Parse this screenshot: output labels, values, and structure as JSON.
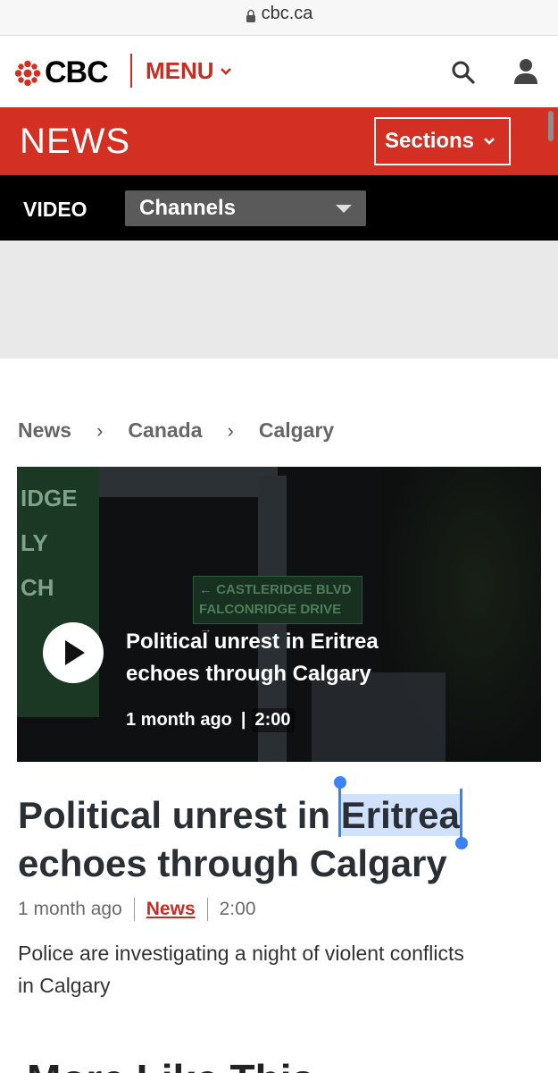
{
  "browser": {
    "url": "cbc.ca",
    "lock_icon": "lock-icon"
  },
  "header": {
    "logo_text": "CBC",
    "menu_label": "MENU",
    "icons": [
      "cbc-gem-icon",
      "chevron-down-icon",
      "search-icon",
      "user-icon"
    ],
    "brand_color": "#d32f23"
  },
  "news_bar": {
    "title": "NEWS",
    "sections_label": "Sections"
  },
  "video_bar": {
    "label": "VIDEO",
    "channels_selected": "Channels"
  },
  "breadcrumb": [
    {
      "label": "News"
    },
    {
      "label": "Canada"
    },
    {
      "label": "Calgary"
    }
  ],
  "player": {
    "title": "Political unrest in Eritrea echoes through Calgary",
    "age": "1 month ago",
    "duration": "2:00",
    "sign_line_1": "← CASTLERIDGE BLVD",
    "sign_line_2": "FALCONRIDGE DRIVE →",
    "bg_text": "IDGE\nLY\nCH"
  },
  "article": {
    "headline_before": "Political unrest in ",
    "headline_selected": "Eritrea",
    "headline_after": " echoes through Calgary",
    "age": "1 month ago",
    "category": "News",
    "duration": "2:00",
    "summary": "Police are investigating a night of violent conflicts in Calgary"
  },
  "more": {
    "heading": "More Like This"
  }
}
